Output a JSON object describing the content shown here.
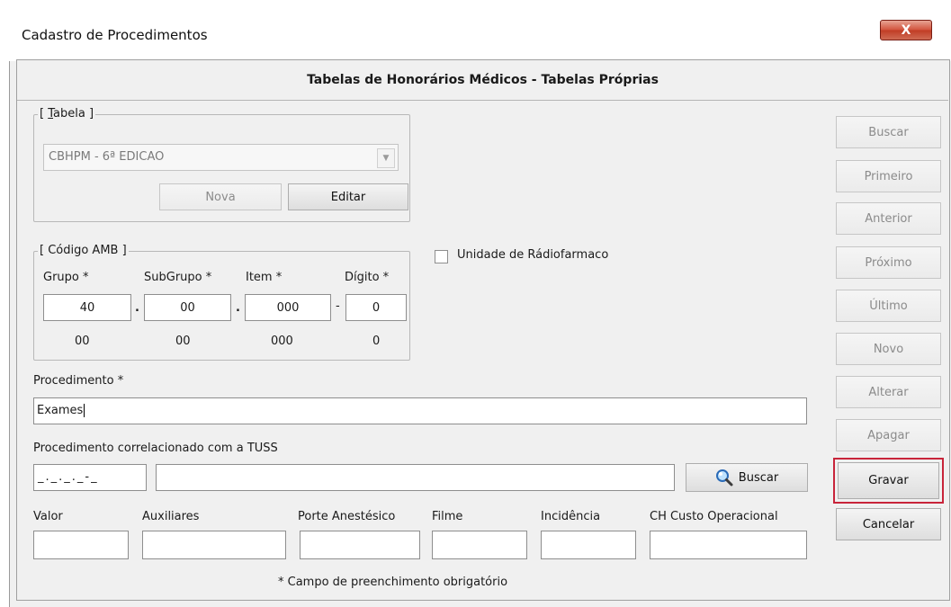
{
  "window": {
    "title": "Cadastro de Procedimentos",
    "close_label": "X"
  },
  "header": {
    "title": "Tabelas de Honorários Médicos - Tabelas Próprias"
  },
  "tabela": {
    "legend": "[ Tabela ]",
    "selected": "CBHPM - 6ª EDICAO",
    "nova_label": "Nova",
    "editar_label": "Editar"
  },
  "codigo_amb": {
    "legend": "[ Código AMB ]",
    "grupo_label": "Grupo *",
    "subgrupo_label": "SubGrupo *",
    "item_label": "Item *",
    "digito_label": "Dígito *",
    "grupo_value": "40",
    "subgrupo_value": "00",
    "item_value": "000",
    "digito_value": "0",
    "sep_dot1": ".",
    "sep_dot2": ".",
    "sep_dash": "-",
    "grupo_display": "00",
    "subgrupo_display": "00",
    "item_display": "000",
    "digito_display": "0"
  },
  "radiofarmaco": {
    "label": "Unidade de Rádiofarmaco",
    "checked": false
  },
  "procedimento": {
    "label": "Procedimento *",
    "value": "Exames"
  },
  "tuss": {
    "label": "Procedimento correlacionado com a TUSS",
    "code_mask": "_._._._-_",
    "description": "",
    "buscar_label": "Buscar"
  },
  "valores": {
    "valor_label": "Valor",
    "auxiliares_label": "Auxiliares",
    "porte_label": "Porte Anestésico",
    "filme_label": "Filme",
    "incidencia_label": "Incidência",
    "ch_label": "CH Custo Operacional"
  },
  "footer": {
    "note": "* Campo de preenchimento obrigatório"
  },
  "nav_buttons": {
    "buscar": "Buscar",
    "primeiro": "Primeiro",
    "anterior": "Anterior",
    "proximo": "Próximo",
    "ultimo": "Último",
    "novo": "Novo",
    "alterar": "Alterar",
    "apagar": "Apagar",
    "gravar": "Gravar",
    "cancelar": "Cancelar"
  },
  "colors": {
    "highlight": "#c8243a",
    "close_button": "#c13c25"
  }
}
